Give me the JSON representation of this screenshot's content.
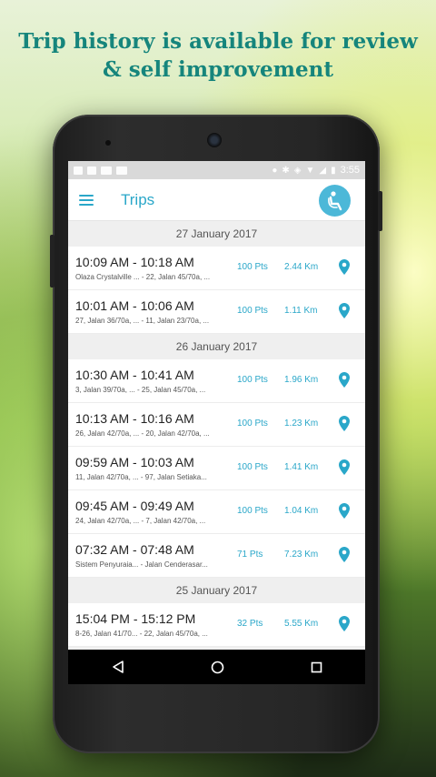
{
  "headline": {
    "line1": "Trip history is available for review",
    "line2": "& self improvement"
  },
  "status_bar": {
    "time": "3:55"
  },
  "app_bar": {
    "title": "Trips"
  },
  "colors": {
    "accent": "#2aa7c9",
    "headline": "#16857c"
  },
  "groups": [
    {
      "date": "27 January 2017",
      "trips": [
        {
          "time": "10:09 AM - 10:18 AM",
          "addr": "Olaza Crystalville ... - 22, Jalan 45/70a, ...",
          "pts": "100 Pts",
          "km": "2.44 Km"
        },
        {
          "time": "10:01 AM - 10:06 AM",
          "addr": "27, Jalan 36/70a, ... - 11, Jalan 23/70a, ...",
          "pts": "100 Pts",
          "km": "1.11 Km"
        }
      ]
    },
    {
      "date": "26 January 2017",
      "trips": [
        {
          "time": "10:30 AM - 10:41 AM",
          "addr": "3, Jalan 39/70a, ... - 25, Jalan 45/70a, ...",
          "pts": "100 Pts",
          "km": "1.96 Km"
        },
        {
          "time": "10:13 AM - 10:16 AM",
          "addr": "26, Jalan 42/70a, ... - 20, Jalan 42/70a, ...",
          "pts": "100 Pts",
          "km": "1.23 Km"
        },
        {
          "time": "09:59 AM - 10:03 AM",
          "addr": "11, Jalan 42/70a, ... - 97, Jalan Setiaka...",
          "pts": "100 Pts",
          "km": "1.41 Km"
        },
        {
          "time": "09:45 AM - 09:49 AM",
          "addr": "24, Jalan 42/70a, ... - 7, Jalan 42/70a, ...",
          "pts": "100 Pts",
          "km": "1.04 Km"
        },
        {
          "time": "07:32 AM - 07:48 AM",
          "addr": "Sistem Penyuraia... - Jalan Cenderasar...",
          "pts": "71 Pts",
          "km": "7.23 Km"
        }
      ]
    },
    {
      "date": "25 January 2017",
      "trips": [
        {
          "time": "15:04 PM - 15:12 PM",
          "addr": "8-26, Jalan 41/70... - 22, Jalan 45/70a, ...",
          "pts": "32 Pts",
          "km": "5.55 Km"
        }
      ]
    }
  ],
  "icons": {
    "menu": "hamburger-menu-icon",
    "profile": "seated-person-icon",
    "location": "map-pin-icon",
    "back": "back-triangle-icon",
    "home": "home-circle-icon",
    "recents": "recents-square-icon"
  }
}
